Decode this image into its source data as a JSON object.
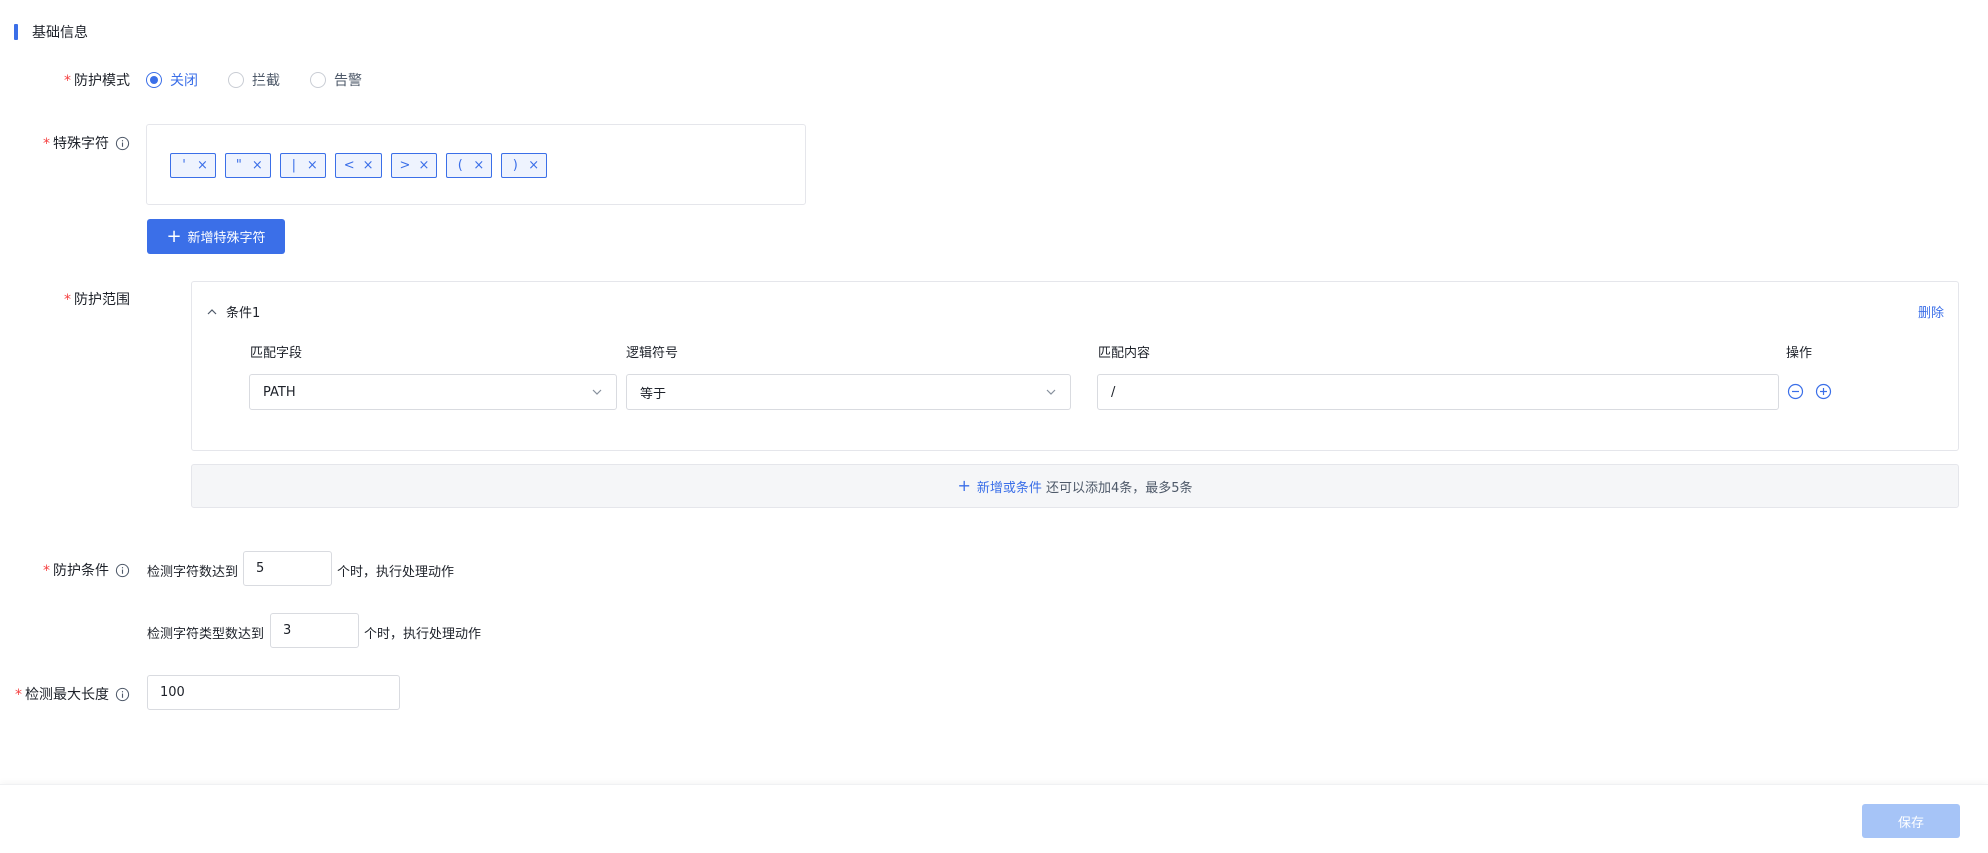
{
  "section": {
    "title": "基础信息"
  },
  "protect_mode": {
    "required_mark": "*",
    "label": "防护模式",
    "options": [
      {
        "label": "关闭",
        "checked": true
      },
      {
        "label": "拦截",
        "checked": false
      },
      {
        "label": "告警",
        "checked": false
      }
    ]
  },
  "special_chars": {
    "required_mark": "*",
    "label": "特殊字符",
    "info_icon": "info-circle-icon",
    "tags": [
      {
        "text": "'",
        "close": "×"
      },
      {
        "text": "\"",
        "close": "×"
      },
      {
        "text": "|",
        "close": "×"
      },
      {
        "text": "<",
        "close": "×"
      },
      {
        "text": ">",
        "close": "×"
      },
      {
        "text": "(",
        "close": "×"
      },
      {
        "text": ")",
        "close": "×"
      }
    ],
    "add_button": {
      "icon": "+",
      "label": "新增特殊字符"
    }
  },
  "protect_scope": {
    "required_mark": "*",
    "label": "防护范围",
    "condition": {
      "title": "条件1",
      "delete_label": "删除",
      "columns": {
        "field": "匹配字段",
        "logic": "逻辑符号",
        "content": "匹配内容",
        "action": "操作"
      },
      "field_value": "PATH",
      "logic_value": "等于",
      "content_value": "/"
    },
    "add_or": {
      "icon": "+",
      "link": "新增或条件",
      "hint": "还可以添加4条，最多5条"
    }
  },
  "protect_condition": {
    "required_mark": "*",
    "label": "防护条件",
    "line1": {
      "prefix": "检测字符数达到",
      "value": "5",
      "suffix": "个时，执行处理动作"
    },
    "line2": {
      "prefix": "检测字符类型数达到",
      "value": "3",
      "suffix": "个时，执行处理动作"
    }
  },
  "max_length": {
    "required_mark": "*",
    "label": "检测最大长度",
    "value": "100"
  },
  "footer": {
    "save_label": "保存"
  },
  "colors": {
    "primary": "#3b6fe8",
    "required": "#f53f3f",
    "disabled_primary": "#a6c4f7"
  }
}
